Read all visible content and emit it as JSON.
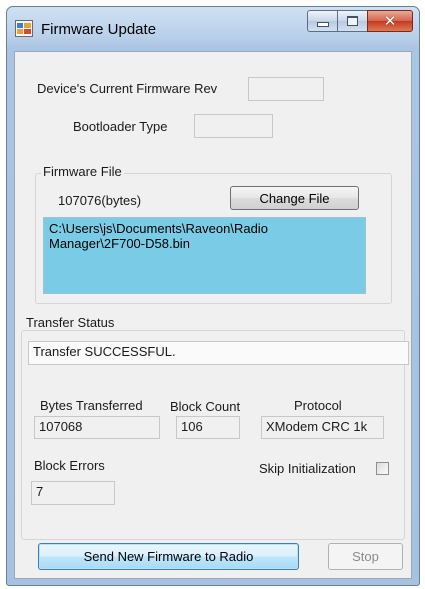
{
  "window": {
    "title": "Firmware Update",
    "colors": {
      "frame": "#a7c1e1",
      "client": "#f0f0f0",
      "path_highlight": "#79cbe6",
      "close_button": "#c33b1f"
    }
  },
  "device": {
    "current_rev_label": "Device's Current Firmware Rev",
    "current_rev_value": "",
    "bootloader_label": "Bootloader Type",
    "bootloader_value": ""
  },
  "firmware_file": {
    "group_title": "Firmware File",
    "size_text": "107076(bytes)",
    "change_button": "Change File",
    "path": "C:\\Users\\js\\Documents\\Raveon\\Radio Manager\\2F700-D58.bin"
  },
  "transfer": {
    "group_title": "Transfer Status",
    "status_text": "Transfer SUCCESSFUL.",
    "bytes_label": "Bytes Transferred",
    "bytes_value": "107068",
    "block_count_label": "Block Count",
    "block_count_value": "106",
    "protocol_label": "Protocol",
    "protocol_value": "XModem CRC 1k",
    "block_errors_label": "Block Errors",
    "block_errors_value": "7",
    "skip_init_label": "Skip Initialization",
    "skip_init_checked": false
  },
  "actions": {
    "send_button": "Send New Firmware to Radio",
    "stop_button": "Stop"
  }
}
